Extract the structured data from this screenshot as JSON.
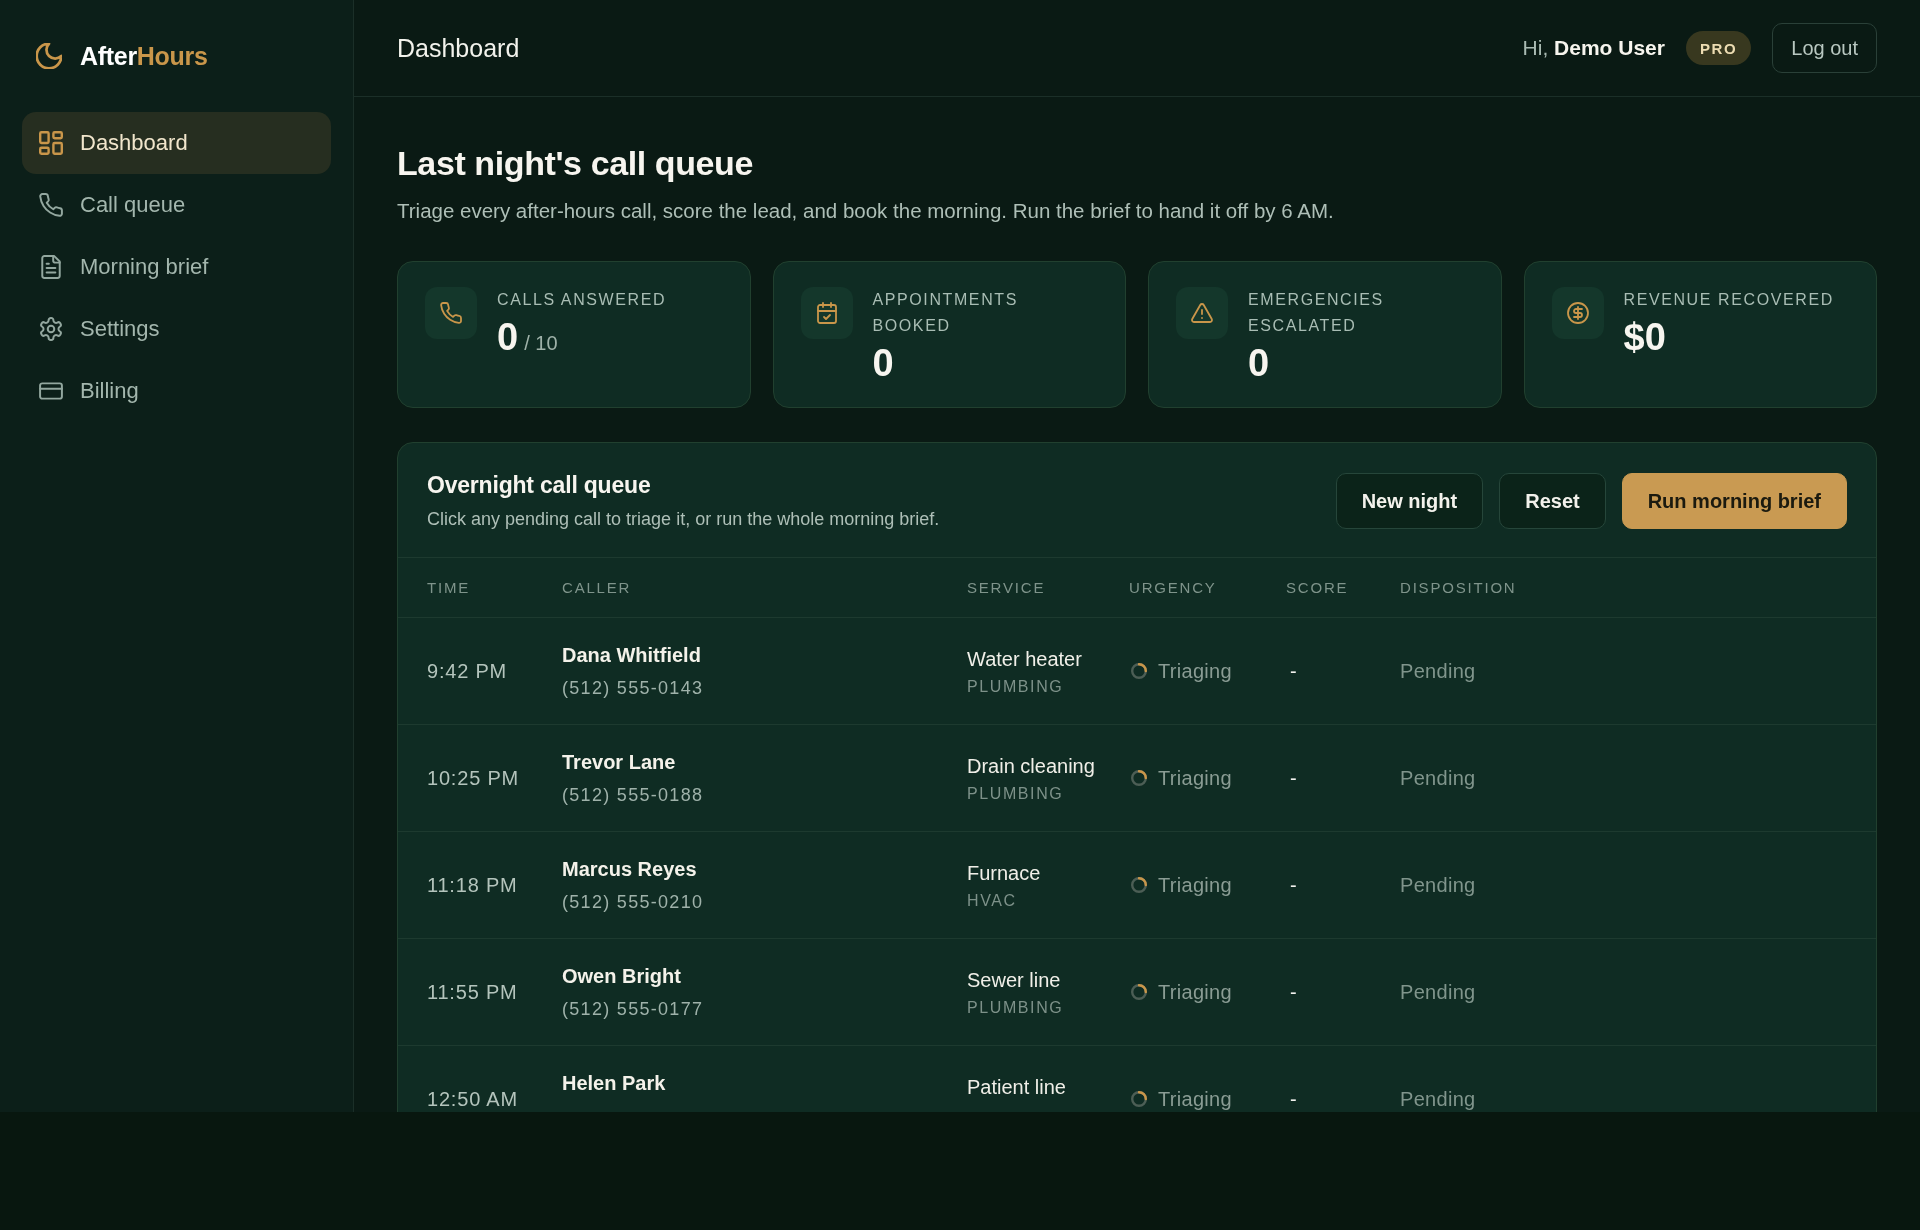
{
  "sidebar": {
    "brand": {
      "name": "After",
      "accent": "Hours"
    },
    "nav": [
      {
        "label": "Dashboard",
        "selected": true
      },
      {
        "label": "Call queue",
        "selected": false
      },
      {
        "label": "Morning brief",
        "selected": false
      },
      {
        "label": "Settings",
        "selected": false
      },
      {
        "label": "Billing",
        "selected": false
      }
    ]
  },
  "header": {
    "title": "Dashboard",
    "greeting": "Hi, **Demo User**",
    "plan_badge": "PRO",
    "logout_button": "Log out"
  },
  "page": {
    "title": "Last night's call queue",
    "subtitle": "Triage every after-hours call, score the lead, and book the morning. Run the brief to hand it off by 6 AM."
  },
  "stats": [
    {
      "label": "CALLS ANSWERED",
      "value": "0",
      "total": "/ 10"
    },
    {
      "label": "APPOINTMENTS BOOKED",
      "value": "0"
    },
    {
      "label": "EMERGENCIES ESCALATED",
      "value": "0"
    },
    {
      "label": "REVENUE RECOVERED",
      "value": "$0"
    }
  ],
  "queue": {
    "title": "Overnight call queue",
    "subtitle": "Click any pending call to triage it, or run the whole morning brief.",
    "buttons": [
      {
        "label": "New night",
        "kind": "secondary"
      },
      {
        "label": "Reset",
        "kind": "secondary"
      },
      {
        "label": "Run morning brief",
        "kind": "primary"
      }
    ],
    "table": {
      "columns": [
        "TIME",
        "CALLER",
        "SERVICE",
        "URGENCY",
        "SCORE",
        "DISPOSITION"
      ],
      "rows": [
        {
          "time": "9:42 PM",
          "caller": "Dana Whitfield",
          "phone": "(512) 555-0143",
          "service": "Water heater",
          "category": "PLUMBING",
          "urgency": "Triaging",
          "score": "-",
          "disposition": "Pending"
        },
        {
          "time": "10:25 PM",
          "caller": "Trevor Lane",
          "phone": "(512) 555-0188",
          "service": "Drain cleaning",
          "category": "PLUMBING",
          "urgency": "Triaging",
          "score": "-",
          "disposition": "Pending"
        },
        {
          "time": "11:18 PM",
          "caller": "Marcus Reyes",
          "phone": "(512) 555-0210",
          "service": "Furnace",
          "category": "HVAC",
          "urgency": "Triaging",
          "score": "-",
          "disposition": "Pending"
        },
        {
          "time": "11:55 PM",
          "caller": "Owen Bright",
          "phone": "(512) 555-0177",
          "service": "Sewer line",
          "category": "PLUMBING",
          "urgency": "Triaging",
          "score": "-",
          "disposition": "Pending"
        },
        {
          "time": "12:50 AM",
          "caller": "Helen Park",
          "service": "Patient line",
          "urgency": "Triaging",
          "score": "-",
          "disposition": "Pending"
        }
      ]
    }
  }
}
